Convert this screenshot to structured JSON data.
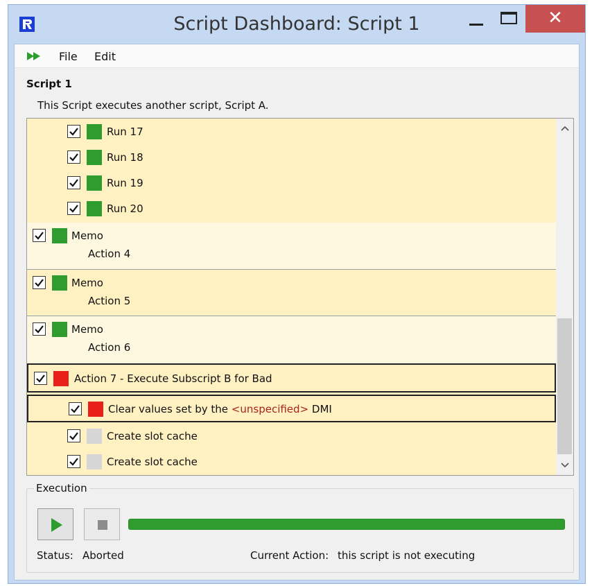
{
  "window": {
    "title": "Script Dashboard: Script 1",
    "close_glyph": "✕"
  },
  "menu": {
    "run_icon": "fast-forward-icon",
    "items": [
      {
        "label": "File"
      },
      {
        "label": "Edit"
      }
    ]
  },
  "script": {
    "name": "Script 1",
    "description": "This Script executes another script, Script A."
  },
  "actions": {
    "runs": [
      {
        "label": "Run 17",
        "checked": true,
        "status": "green"
      },
      {
        "label": "Run 18",
        "checked": true,
        "status": "green"
      },
      {
        "label": "Run 19",
        "checked": true,
        "status": "green"
      },
      {
        "label": "Run 20",
        "checked": true,
        "status": "green"
      }
    ],
    "memos": [
      {
        "type": "Memo",
        "name": "Action 4",
        "checked": true,
        "status": "green"
      },
      {
        "type": "Memo",
        "name": "Action 5",
        "checked": true,
        "status": "green"
      },
      {
        "type": "Memo",
        "name": "Action 6",
        "checked": true,
        "status": "green"
      }
    ],
    "action7": {
      "label": "Action 7 - Execute Subscript B for Bad",
      "checked": true,
      "status": "red"
    },
    "subitems": [
      {
        "prefix": "Clear values set by the ",
        "unspecified": "<unspecified>",
        "suffix": " DMI",
        "checked": true,
        "status": "red"
      },
      {
        "label": "Create slot cache",
        "checked": true,
        "status": "grey"
      },
      {
        "label": "Create slot cache",
        "checked": true,
        "status": "grey"
      }
    ]
  },
  "execution": {
    "group_label": "Execution",
    "progress": 1.0,
    "status_label": "Status:",
    "status_value": "Aborted",
    "current_action_label": "Current Action:",
    "current_action_value": "this script is not executing"
  },
  "colors": {
    "status_green": "#2e9c2e",
    "status_red": "#e8201a",
    "status_grey": "#d6d6d6",
    "row_dark": "#fff1c2",
    "row_light": "#fff8e0",
    "close_button": "#c75050",
    "unspecified_text": "#a8241d"
  }
}
